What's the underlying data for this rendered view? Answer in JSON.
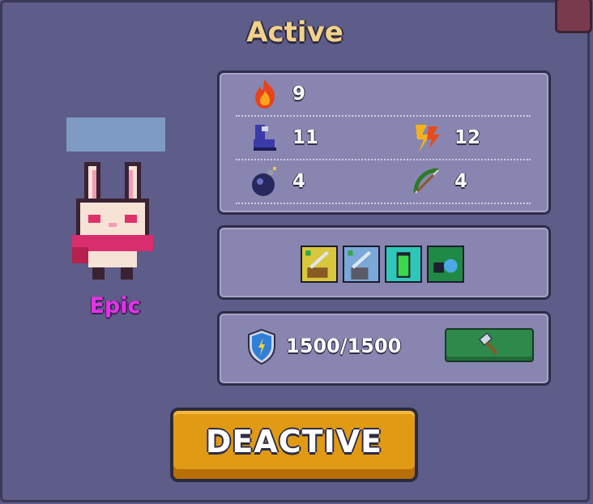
{
  "title": "Active",
  "pet": {
    "name_placeholder": "",
    "rarity": "Epic"
  },
  "stats": {
    "fire": "9",
    "speed_boots": "11",
    "lightning": "12",
    "bomb": "4",
    "bow": "4"
  },
  "skills": [
    "sword-chest-skill-icon",
    "sword-trash-skill-icon",
    "battery-skill-icon",
    "blue-creature-skill-icon"
  ],
  "armor": {
    "value": "1500/1500"
  },
  "actions": {
    "deactive_label": "DEACTIVE"
  },
  "colors": {
    "title": "#f2d28a",
    "rarity": "#e632e6",
    "button": "#e09a14",
    "upgrade": "#2e8a4a"
  }
}
